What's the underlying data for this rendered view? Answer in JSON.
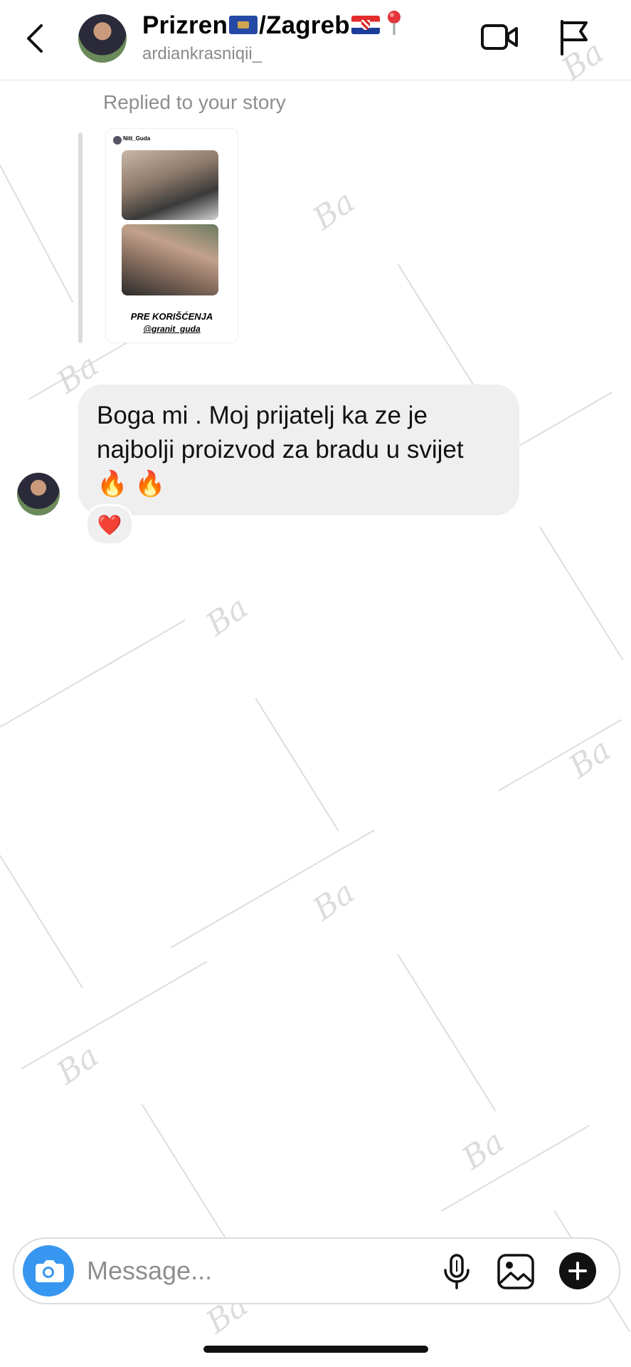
{
  "header": {
    "title_left": "Prizren",
    "title_mid": "/Zagreb",
    "username": "ardiankrasniqii_"
  },
  "story_reply": {
    "label": "Replied to your story",
    "story_user": "Nitt_Guda",
    "caption": "PRE KORIŠĆENJA",
    "handle": "@granit_guda"
  },
  "message": {
    "text": "Boga mi . Moj prijatelj ka ze je najbolji proizvod za bradu u svijet",
    "emojis": "🔥 🔥",
    "reaction": "❤️"
  },
  "composer": {
    "placeholder": "Message..."
  },
  "colors": {
    "accent": "#3797f0",
    "bubble": "#efefef",
    "muted": "#8e8e8e"
  },
  "icons": [
    "back-arrow-icon",
    "video-call-icon",
    "flag-icon",
    "camera-icon",
    "microphone-icon",
    "gallery-icon",
    "plus-icon",
    "location-pin-icon"
  ]
}
